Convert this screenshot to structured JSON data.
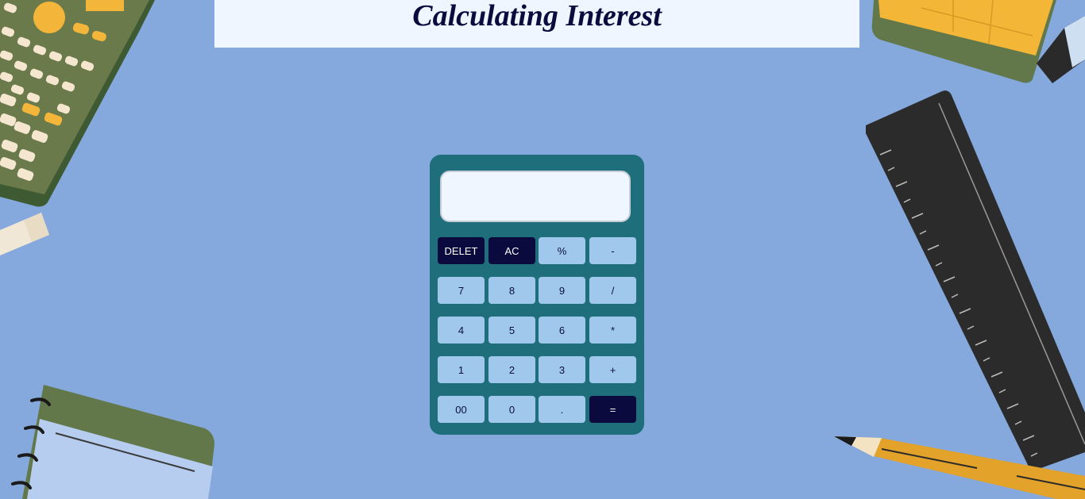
{
  "header": {
    "title": "Calculating Interest"
  },
  "calculator": {
    "display_value": "",
    "keys": [
      [
        "DELET",
        "AC",
        "%",
        "-"
      ],
      [
        "7",
        "8",
        "9",
        "/"
      ],
      [
        "4",
        "5",
        "6",
        "*"
      ],
      [
        "1",
        "2",
        "3",
        "+"
      ],
      [
        "00",
        "0",
        ".",
        "="
      ]
    ]
  },
  "colors": {
    "background": "#85a9dd",
    "title_bar": "#eff6ff",
    "calculator_body": "#1e6f7b",
    "key": "#9fc8ec",
    "key_dark": "#0a0a3e"
  },
  "decorations": [
    "calculator-illustration",
    "eraser-illustration",
    "book-illustration",
    "ruler-illustration",
    "notebook-illustration",
    "pencil-illustration"
  ]
}
